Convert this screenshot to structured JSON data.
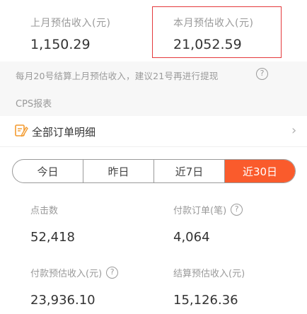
{
  "earnings": {
    "last_month": {
      "label": "上月预估收入(元)",
      "value": "1,150.29"
    },
    "this_month": {
      "label": "本月预估收入(元)",
      "value": "21,052.59"
    }
  },
  "notice": {
    "text": "每月20号结算上月预估收入，建议21号再进行提现",
    "help_icon": "question-icon"
  },
  "cps": {
    "title": "CPS报表"
  },
  "orders": {
    "label": "全部订单明细",
    "icon": "edit-document-icon",
    "chevron": "›"
  },
  "range_tabs": [
    {
      "label": "今日",
      "active": false
    },
    {
      "label": "昨日",
      "active": false
    },
    {
      "label": "近7日",
      "active": false
    },
    {
      "label": "近30日",
      "active": true
    }
  ],
  "stats": {
    "clicks": {
      "label": "点击数",
      "value": "52,418"
    },
    "paid_orders": {
      "label": "付款订单(笔)",
      "value": "4,064"
    },
    "paid_income": {
      "label": "付款预估收入(元)",
      "value": "23,936.10"
    },
    "settled_income": {
      "label": "结算预估收入(元)",
      "value": "15,126.36"
    }
  },
  "colors": {
    "accent": "#fa5b2c",
    "highlight_border": "#e4393c",
    "muted_text": "#9a9a9a"
  }
}
